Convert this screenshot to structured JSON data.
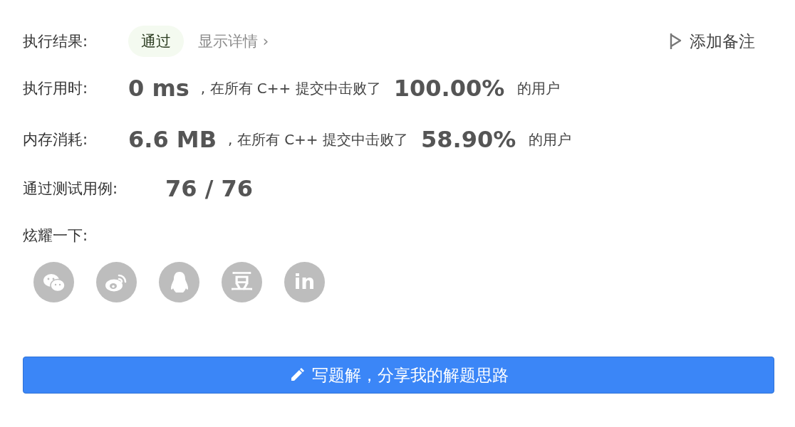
{
  "result": {
    "label": "执行结果:",
    "status": "通过",
    "details_link": "显示详情 ›",
    "add_note": "添加备注"
  },
  "stats": [
    {
      "label": "执行用时:",
      "value": "0 ms",
      "middle": ", 在所有 C++ 提交中击败了",
      "percent": "100.00%",
      "suffix": "的用户"
    },
    {
      "label": "内存消耗:",
      "value": "6.6 MB",
      "middle": ", 在所有 C++ 提交中击败了",
      "percent": "58.90%",
      "suffix": "的用户"
    }
  ],
  "tests": {
    "label": "通过测试用例:",
    "value": "76 / 76"
  },
  "share": {
    "label": "炫耀一下:",
    "items": [
      {
        "kind": "wechat"
      },
      {
        "kind": "weibo"
      },
      {
        "kind": "qq"
      },
      {
        "kind": "glyph",
        "text": "豆"
      },
      {
        "kind": "glyph",
        "text": "in"
      }
    ]
  },
  "write_button": "写题解，分享我的解题思路"
}
